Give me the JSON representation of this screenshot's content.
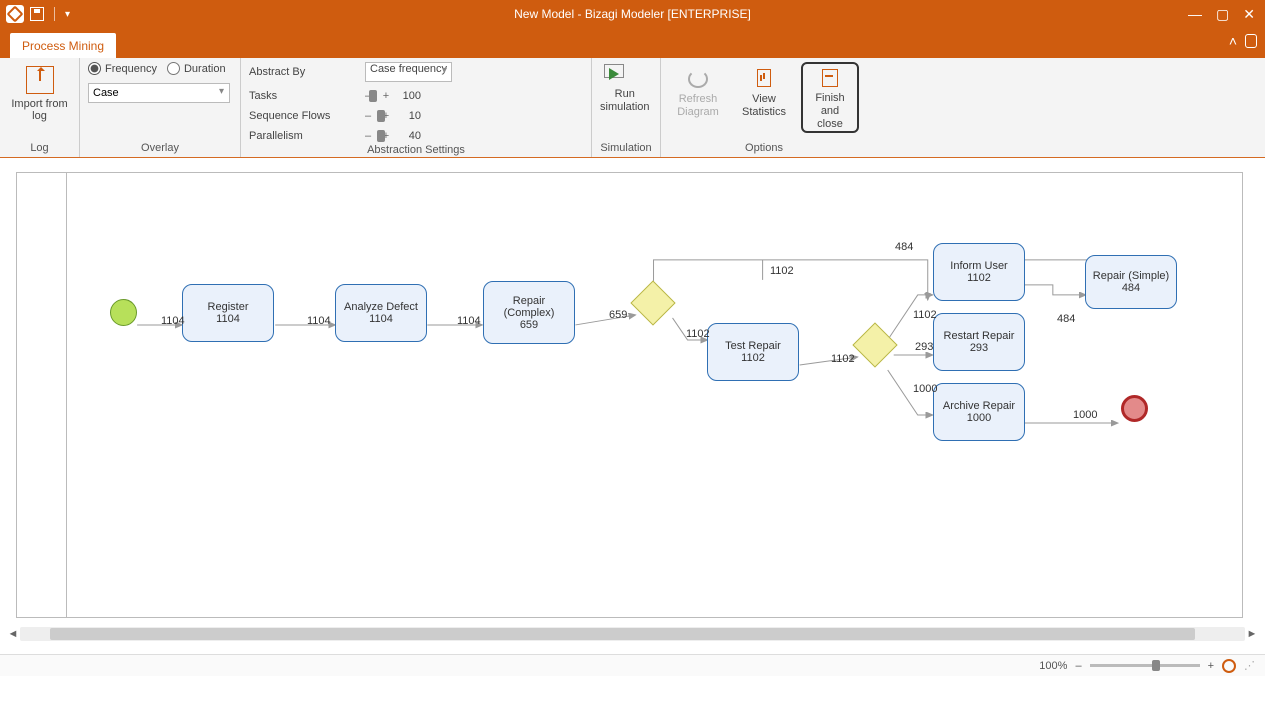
{
  "title": "New Model - Bizagi Modeler [ENTERPRISE]",
  "tab": "Process Mining",
  "ribbon": {
    "log": {
      "import_label": "Import from\nlog",
      "caption": "Log"
    },
    "overlay": {
      "freq_label": "Frequency",
      "dur_label": "Duration",
      "select_value": "Case",
      "caption": "Overlay"
    },
    "abstraction": {
      "abstract_by": "Abstract By",
      "abstract_value": "Case frequency",
      "tasks": "Tasks",
      "tasks_val": "100",
      "seqflows": "Sequence Flows",
      "seqflows_val": "10",
      "parallelism": "Parallelism",
      "parallelism_val": "40",
      "caption": "Abstraction Settings"
    },
    "simulation": {
      "run": "Run\nsimulation",
      "caption": "Simulation"
    },
    "options": {
      "refresh": "Refresh\nDiagram",
      "view": "View\nStatistics",
      "finish": "Finish and\nclose",
      "caption": "Options"
    }
  },
  "diagram": {
    "start_out": "1104",
    "tasks": {
      "register": {
        "name": "Register",
        "count": "1104"
      },
      "analyze": {
        "name": "Analyze Defect",
        "count": "1104"
      },
      "repair_complex": {
        "name": "Repair\n(Complex)",
        "count": "659"
      },
      "test_repair": {
        "name": "Test Repair",
        "count": "1102"
      },
      "inform_user": {
        "name": "Inform User",
        "count": "1102"
      },
      "restart_repair": {
        "name": "Restart Repair",
        "count": "293"
      },
      "archive_repair": {
        "name": "Archive Repair",
        "count": "1000"
      },
      "repair_simple": {
        "name": "Repair (Simple)",
        "count": "484"
      }
    },
    "labels": {
      "reg_out": "1104",
      "analyze_out": "1104",
      "rc_out": "659",
      "gw1_down": "1102",
      "gw1_top1": "1102",
      "gw1_top2": "484",
      "test_out": "1102",
      "gw2_top": "1102",
      "gw2_mid": "293",
      "gw2_bot": "1000",
      "rs_out": "484",
      "archive_out": "1000"
    }
  },
  "status": {
    "zoom": "100%"
  }
}
